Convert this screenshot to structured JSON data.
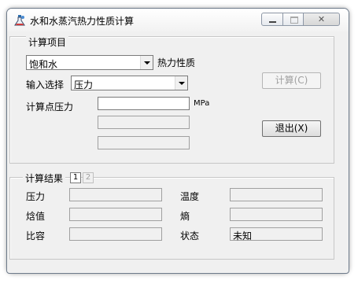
{
  "window": {
    "title": "水和水蒸汽热力性质计算"
  },
  "title_controls": {
    "min": "minimize",
    "max": "maximize",
    "close_glyph": "✕"
  },
  "calc_group": {
    "legend": "计算项目",
    "property_combo_value": "饱和水",
    "property_label": "热力性质",
    "input_select_label": "输入选择",
    "input_select_value": "压力",
    "point_label": "计算点压力",
    "point_value": "",
    "unit": "MPa",
    "extra_field_1": "",
    "extra_field_2": "",
    "calc_button": "计算(C)",
    "exit_button": "退出(X)"
  },
  "result_group": {
    "legend": "计算结果",
    "tabs": [
      "1",
      "2"
    ],
    "rows": [
      {
        "left_label": "压力",
        "left_value": "",
        "right_label": "温度",
        "right_value": ""
      },
      {
        "left_label": "焓值",
        "left_value": "",
        "right_label": "熵",
        "right_value": ""
      },
      {
        "left_label": "比容",
        "left_value": "",
        "right_label": "状态",
        "right_value": "未知"
      }
    ]
  }
}
